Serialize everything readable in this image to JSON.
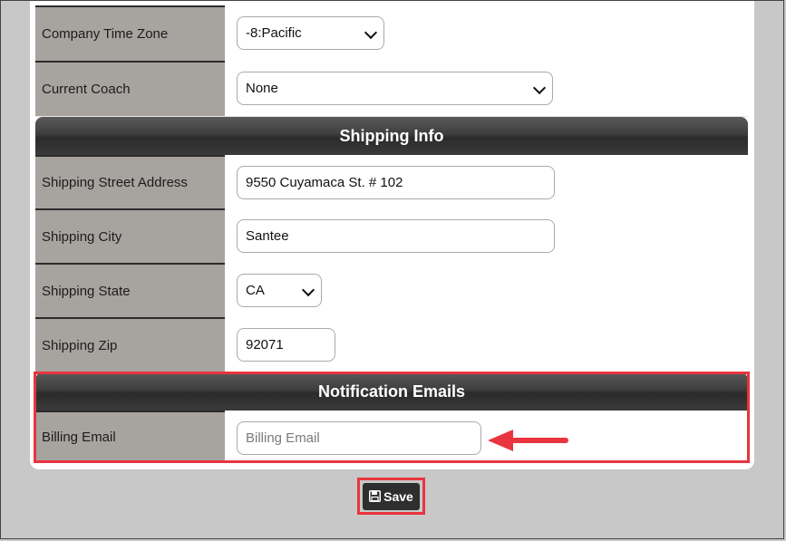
{
  "form": {
    "company_time_zone": {
      "label": "Company Time Zone",
      "value": "-8:Pacific"
    },
    "current_coach": {
      "label": "Current Coach",
      "value": "None"
    },
    "shipping_header": "Shipping Info",
    "shipping_street": {
      "label": "Shipping Street Address",
      "value": "9550 Cuyamaca St. # 102"
    },
    "shipping_city": {
      "label": "Shipping City",
      "value": "Santee"
    },
    "shipping_state": {
      "label": "Shipping State",
      "value": "CA"
    },
    "shipping_zip": {
      "label": "Shipping Zip",
      "value": "92071"
    },
    "notification_header": "Notification Emails",
    "billing_email": {
      "label": "Billing Email",
      "value": "",
      "placeholder": "Billing Email"
    }
  },
  "toolbar": {
    "save_label": "Save"
  },
  "icons": {
    "save": "floppy-disk-icon",
    "annotation": "arrow-left-icon"
  },
  "colors": {
    "highlight": "#e8353f",
    "header": "#3a3a3a",
    "label_bg": "#a7a4a0"
  }
}
